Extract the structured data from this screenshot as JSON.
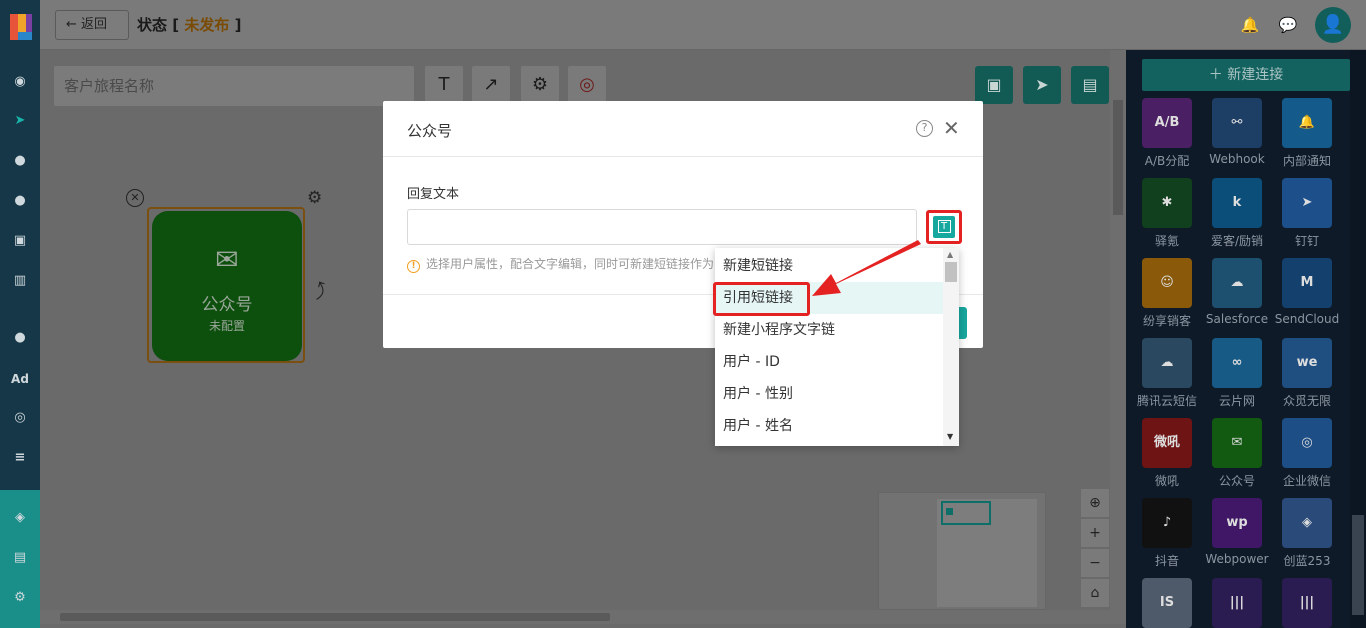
{
  "header": {
    "back_label": "返回",
    "status_label": "状态",
    "status_value": "未发布"
  },
  "toolbar": {
    "journey_name_placeholder": "客户旅程名称"
  },
  "node": {
    "title": "公众号",
    "subtitle": "未配置"
  },
  "right_panel": {
    "new_connection_label": "新建连接",
    "connectors": [
      {
        "name": "A/B分配",
        "color": "#4a1f63",
        "glyph": "A/B"
      },
      {
        "name": "Webhook",
        "color": "#1d3f66",
        "glyph": "⚯"
      },
      {
        "name": "内部通知",
        "color": "#145a8a",
        "glyph": "🔔"
      },
      {
        "name": "驿氪",
        "color": "#10401d",
        "glyph": "✱"
      },
      {
        "name": "爱客/励销",
        "color": "#0b4e7a",
        "glyph": "k"
      },
      {
        "name": "钉钉",
        "color": "#1d4f8a",
        "glyph": "➤"
      },
      {
        "name": "纷享销客",
        "color": "#8a5a0a",
        "glyph": "☺"
      },
      {
        "name": "Salesforce",
        "color": "#1d4f6e",
        "glyph": "☁"
      },
      {
        "name": "SendCloud",
        "color": "#14406e",
        "glyph": "M"
      },
      {
        "name": "腾讯云短信",
        "color": "#2a4860",
        "glyph": "☁"
      },
      {
        "name": "云片网",
        "color": "#175a86",
        "glyph": "∞"
      },
      {
        "name": "众觅无限",
        "color": "#1f4f80",
        "glyph": "we"
      },
      {
        "name": "微吼",
        "color": "#6e1414",
        "glyph": "微吼"
      },
      {
        "name": "公众号",
        "color": "#125a12",
        "glyph": "✉"
      },
      {
        "name": "企业微信",
        "color": "#1d4f86",
        "glyph": "◎"
      },
      {
        "name": "抖音",
        "color": "#111",
        "glyph": "♪"
      },
      {
        "name": "Webpower",
        "color": "#3f1766",
        "glyph": "wp"
      },
      {
        "name": "创蓝253",
        "color": "#2a4a7a",
        "glyph": "◈"
      },
      {
        "name": "",
        "color": "#4e5a6a",
        "glyph": "IS"
      },
      {
        "name": "",
        "color": "#2a1b50",
        "glyph": "|||"
      },
      {
        "name": "",
        "color": "#2a1b50",
        "glyph": "|||"
      }
    ]
  },
  "dialog": {
    "title": "公众号",
    "field_label": "回复文本",
    "reply_text_value": "",
    "hint": "选择用户属性，配合文字编辑，同时可新建短链接作为"
  },
  "dropdown": {
    "items": [
      "新建短链接",
      "引用短链接",
      "新建小程序文字链",
      "用户 - ID",
      "用户 - 性别",
      "用户 - 姓名"
    ],
    "active_index": 1
  }
}
